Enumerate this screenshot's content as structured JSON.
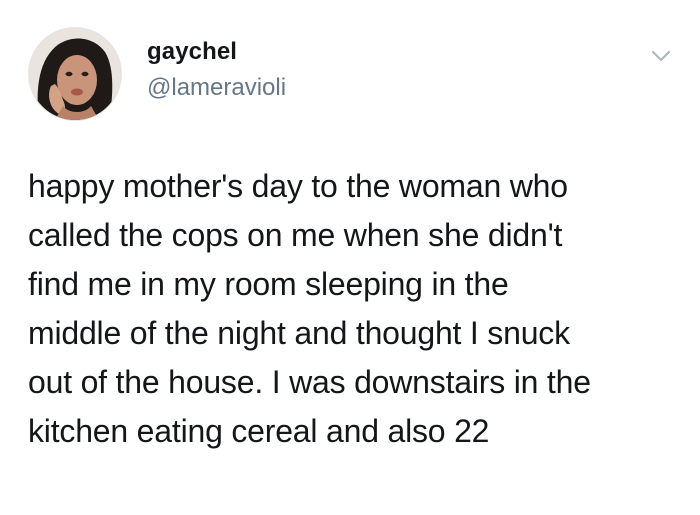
{
  "tweet": {
    "author": {
      "display_name": "gaychel",
      "handle": "@lameravioli"
    },
    "menu_icon": "chevron-down-icon",
    "text_lines": [
      "happy mother's day to the woman who",
      "called the cops on me when she didn't",
      "find me in my room sleeping in the",
      "middle of the night and thought I snuck",
      "out of the house. I was downstairs in the",
      "kitchen eating cereal and also 22"
    ]
  },
  "colors": {
    "text": "#14171a",
    "secondary_text": "#657786",
    "caret": "#aab8c2",
    "background": "#ffffff"
  }
}
